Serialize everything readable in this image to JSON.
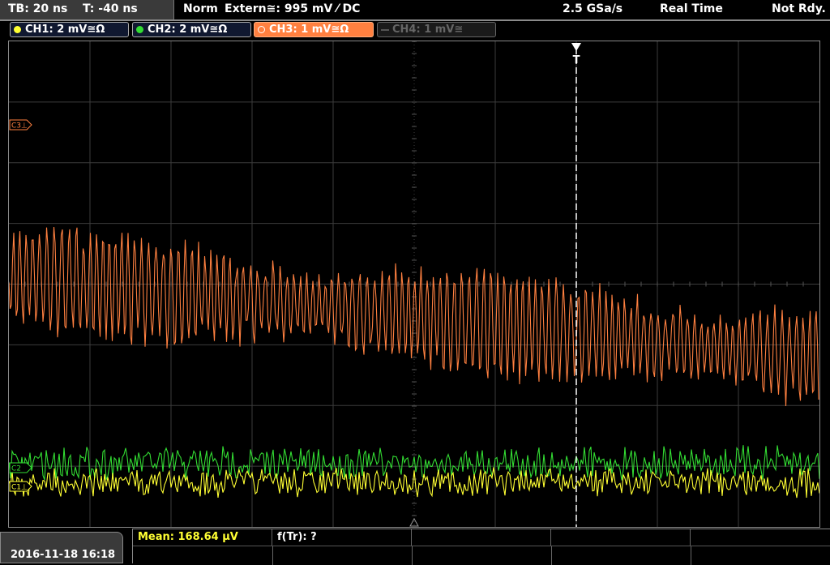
{
  "topbar": {
    "timebase": "TB: 20 ns",
    "trigger_time": "T: -40 ns",
    "trigger_mode": "Norm",
    "trigger_source": "Extern≅: 995 mV ⁄ DC",
    "sample_rate": "2.5 GSa/s",
    "acq_mode": "Real Time",
    "status": "Not Rdy."
  },
  "channels": [
    {
      "label": "CH1: 2 mV≅Ω",
      "color": "#ffff33",
      "active": false,
      "enabled": true
    },
    {
      "label": "CH2: 2 mV≅Ω",
      "color": "#33dd33",
      "active": false,
      "enabled": true
    },
    {
      "label": "CH3: 1 mV≅Ω",
      "color": "#ff8040",
      "active": true,
      "enabled": true
    },
    {
      "label": "CH4: 1 mV≅",
      "color": "#777777",
      "active": false,
      "enabled": false
    }
  ],
  "markers": {
    "c3": "C3⊥",
    "c2": "C2",
    "c1": "C1⊥",
    "trigger": "T"
  },
  "measurements": {
    "mean": "Mean: 168.64 µV",
    "freq": "f(Tr): ?"
  },
  "datetime": "2016-11-18 16:18",
  "colors": {
    "ch1": "#ffff33",
    "ch2": "#33dd33",
    "ch3": "#ff8040",
    "grid": "#3c3c3c",
    "active_tab": "#ff8040"
  }
}
